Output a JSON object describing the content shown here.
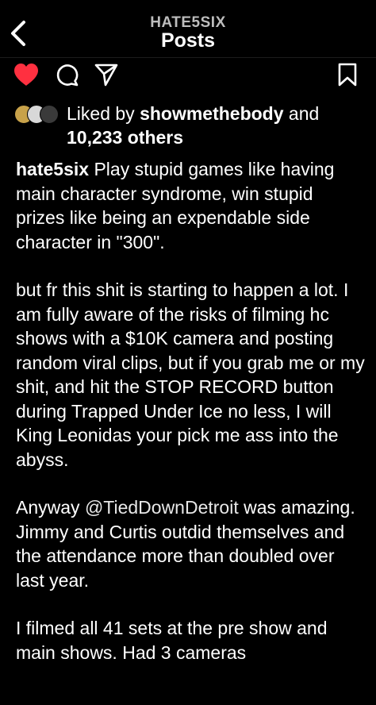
{
  "header": {
    "subtitle": "HATE5SIX",
    "title": "Posts"
  },
  "likes": {
    "prefix": "Liked by ",
    "user": "showmethebody",
    "mid": " and",
    "count": "10,233 others"
  },
  "caption": {
    "username": "hate5six",
    "p1": " Play stupid games like having main character syndrome, win stupid prizes like being an expendable side character in \"300\".",
    "p2": "but fr this shit is starting to happen a lot. I am fully aware of the risks of filming hc shows with a $10K camera and posting random viral clips, but if you grab me or my shit, and hit the STOP RECORD button during Trapped Under Ice no less, I will King Leonidas your pick me ass into the abyss.",
    "p3_pre": "Anyway ",
    "p3_mention": "@TiedDownDetroit",
    "p3_post": " was amazing. Jimmy and Curtis outdid themselves and the attendance more than doubled over last year.",
    "p4": "I filmed all 41 sets at the pre show and main shows. Had 3 cameras"
  },
  "icons": {
    "back": "chevron-left-icon",
    "like": "heart-filled-icon",
    "comment": "comment-bubble-icon",
    "share": "paper-plane-icon",
    "save": "bookmark-icon"
  },
  "colors": {
    "background": "#000000",
    "like": "#ff3040",
    "text": "#ffffff"
  }
}
